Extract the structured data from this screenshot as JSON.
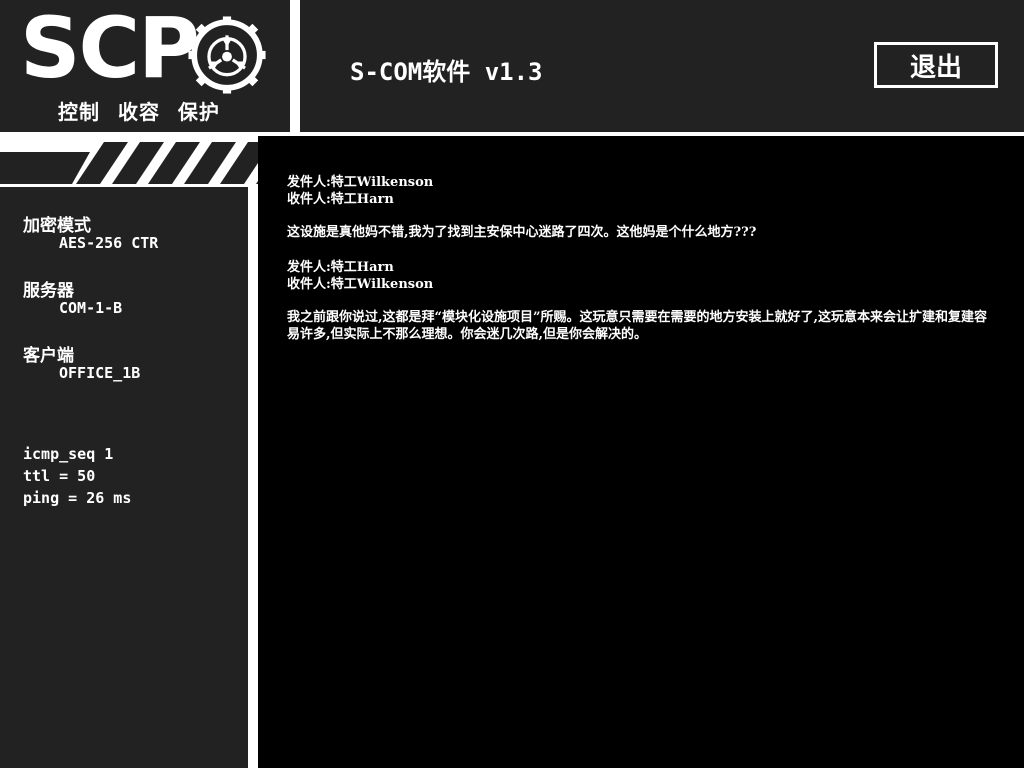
{
  "logo": {
    "wordmark": "SCP",
    "tagline": "控制 收容 保护",
    "seal_icon": "scp-foundation-seal-icon"
  },
  "header": {
    "title": "S-COM软件 v1.3",
    "exit_label": "退出"
  },
  "sidebar": {
    "encryption": {
      "label": "加密模式",
      "value": "AES-256 CTR"
    },
    "server": {
      "label": "服务器",
      "value": "COM-1-B"
    },
    "client": {
      "label": "客户端",
      "value": "OFFICE_1B"
    },
    "ping": {
      "seq": "icmp_seq 1",
      "ttl": "ttl = 50",
      "ping": "ping = 26 ms"
    }
  },
  "messages": [
    {
      "sender": "发件人:特工Wilkenson",
      "recipient": "收件人:特工Harn",
      "body": "这设施是真他妈不错,我为了找到主安保中心迷路了四次。这他妈是个什么地方???"
    },
    {
      "sender": "发件人:特工Harn",
      "recipient": "收件人:特工Wilkenson",
      "body": "我之前跟你说过,这都是拜“模块化设施项目”所赐。这玩意只需要在需要的地方安装上就好了,这玩意本来会让扩建和复建容易许多,但实际上不那么理想。你会迷几次路,但是你会解决的。"
    }
  ],
  "colors": {
    "panel": "#222222",
    "content_bg": "#000000",
    "frame": "#ffffff",
    "text": "#ffffff"
  }
}
